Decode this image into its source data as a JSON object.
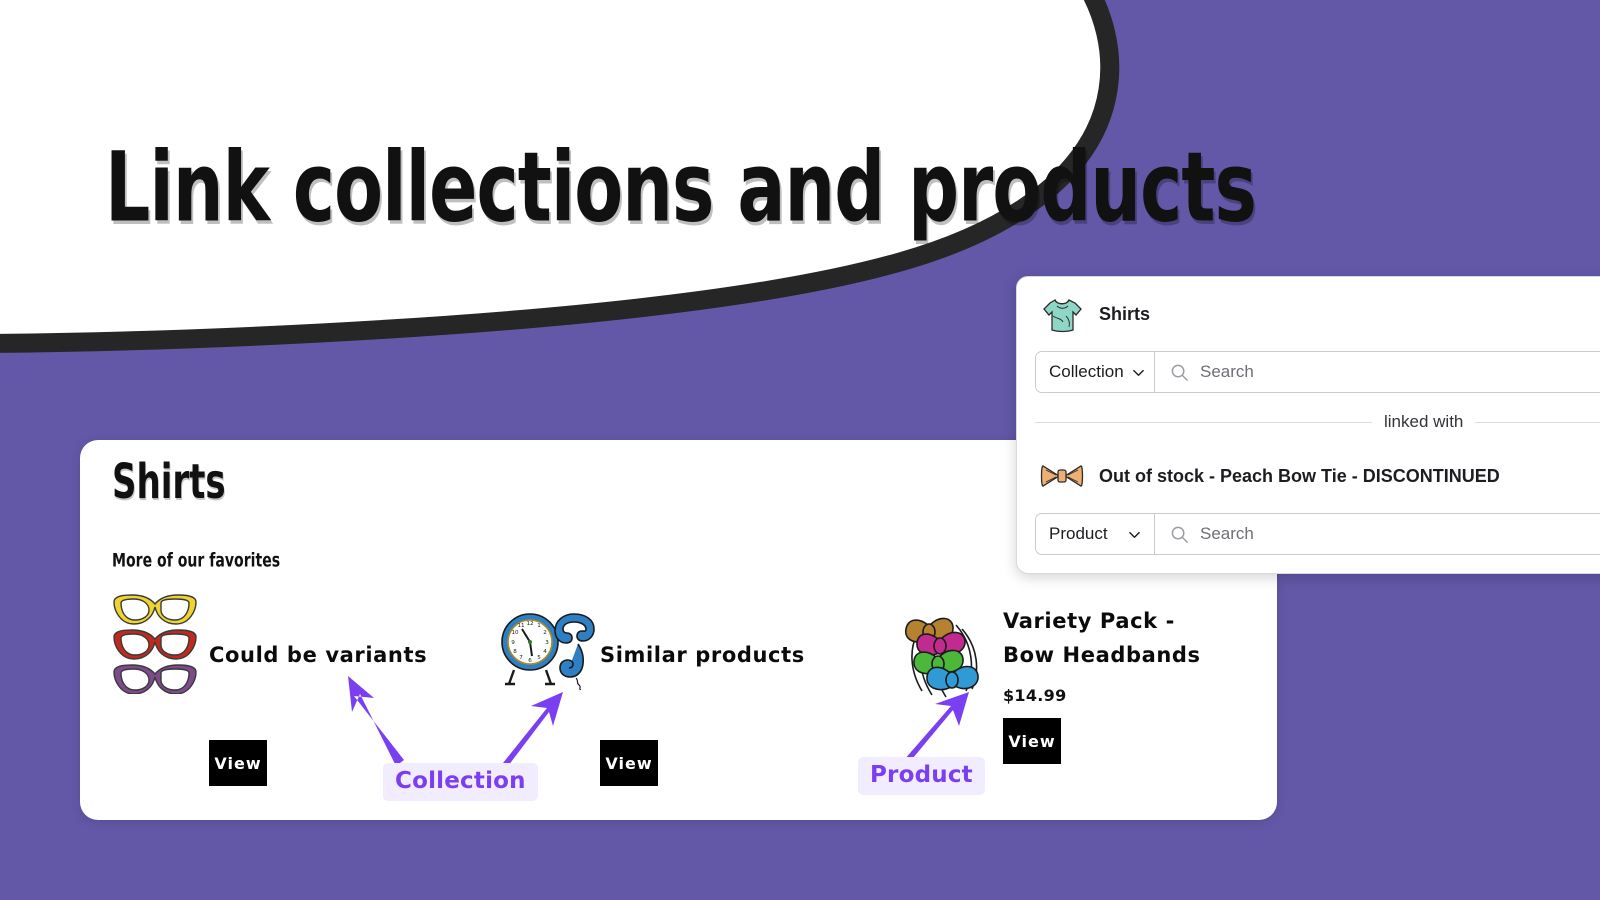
{
  "theme": {
    "background_purple": "#6258a7",
    "accent_purple": "#7b3ff2",
    "badge_background": "#f1edff",
    "card_white": "#ffffff",
    "button_black": "#000000"
  },
  "hero": {
    "title": "Link collections and products"
  },
  "content_card": {
    "heading": "Shirts",
    "subheading": "More of our favorites",
    "tiles": [
      {
        "id": "could-be-variants",
        "thumb_icon": "glasses-stack-icon",
        "label": "Could be variants",
        "price": "",
        "view_label": "View"
      },
      {
        "id": "similar-products",
        "thumb_icon": "clock-phone-icon",
        "label": "Similar products",
        "price": "",
        "view_label": "View"
      },
      {
        "id": "variety-pack",
        "thumb_icon": "bow-headbands-icon",
        "label": "Variety Pack - Bow Headbands",
        "price": "$14.99",
        "view_label": "View"
      }
    ]
  },
  "annotations": [
    {
      "id": "collection",
      "label": "Collection"
    },
    {
      "id": "product",
      "label": "Product"
    }
  ],
  "link_panel": {
    "collection_item": {
      "thumb_icon": "tshirt-icon",
      "title": "Shirts"
    },
    "collection_search": {
      "type_label": "Collection",
      "chevron_icon": "chevron-down-icon",
      "search_icon": "search-icon",
      "placeholder": "Search",
      "value": ""
    },
    "divider_label": "linked with",
    "product_item": {
      "thumb_icon": "bowtie-icon",
      "title": "Out of stock - Peach Bow Tie - DISCONTINUED"
    },
    "product_search": {
      "type_label": "Product",
      "chevron_icon": "chevron-down-icon",
      "search_icon": "search-icon",
      "placeholder": "Search",
      "value": ""
    }
  }
}
